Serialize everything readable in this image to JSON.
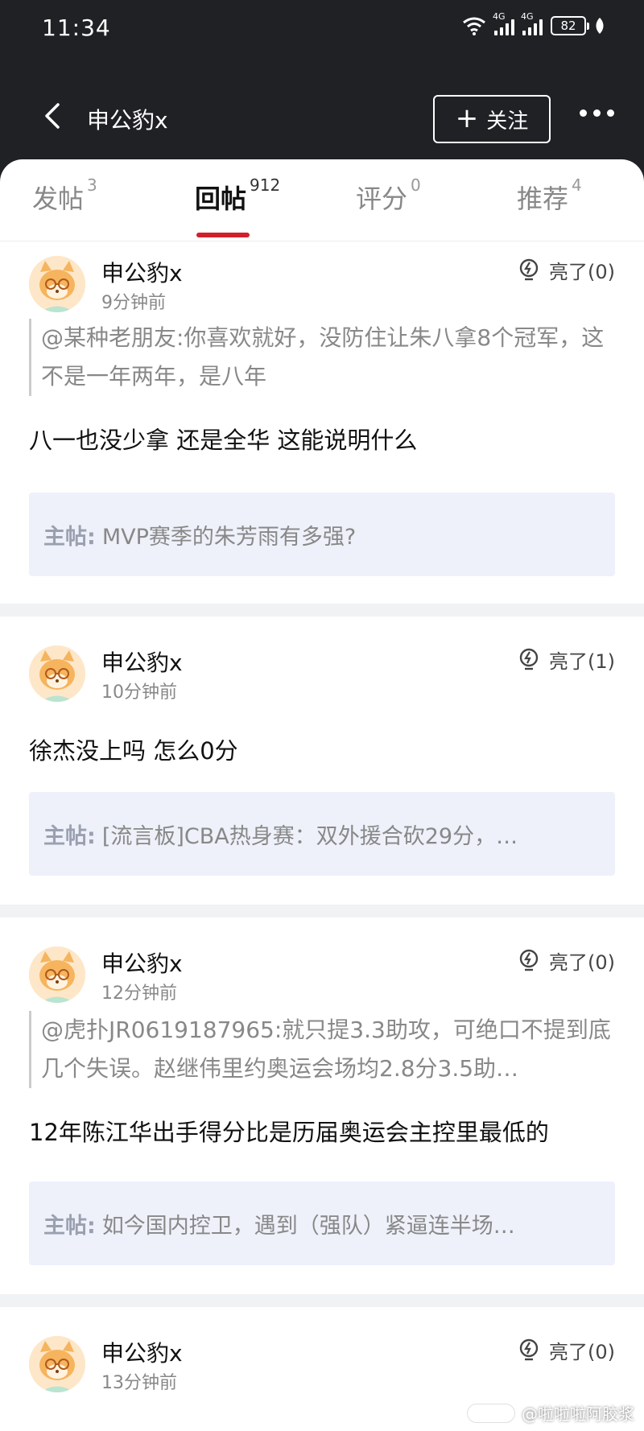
{
  "status_bar": {
    "time": "11:34",
    "signal_label_1": "4G",
    "signal_label_2": "4G",
    "battery": "82"
  },
  "header": {
    "title": "申公豹x",
    "follow_label": "关注"
  },
  "tabs": [
    {
      "label": "发帖",
      "count": "3",
      "active": false
    },
    {
      "label": "回帖",
      "count": "912",
      "active": true
    },
    {
      "label": "评分",
      "count": "0",
      "active": false
    },
    {
      "label": "推荐",
      "count": "4",
      "active": false
    }
  ],
  "main_post_label": "主帖:",
  "posts": [
    {
      "username": "申公豹x",
      "time": "9分钟前",
      "likes": "亮了(0)",
      "quote": "@某种老朋友:你喜欢就好，没防住让朱八拿8个冠军，这不是一年两年，是八年",
      "body": "八一也没少拿   还是全华  这能说明什么",
      "main_post": "MVP赛季的朱芳雨有多强?"
    },
    {
      "username": "申公豹x",
      "time": "10分钟前",
      "likes": "亮了(1)",
      "body": "徐杰没上吗  怎么0分",
      "main_post": "[流言板]CBA热身赛：双外援合砍29分，…"
    },
    {
      "username": "申公豹x",
      "time": "12分钟前",
      "likes": "亮了(0)",
      "quote": "@虎扑JR0619187965:就只提3.3助攻，可绝口不提到底几个失误。赵继伟里约奥运会场均2.8分3.5助…",
      "body": "12年陈江华出手得分比是历届奥运会主控里最低的",
      "main_post": "如今国内控卫，遇到（强队）紧逼连半场…"
    },
    {
      "username": "申公豹x",
      "time": "13分钟前",
      "likes": "亮了(0)"
    }
  ],
  "watermark": "@啦啦啦阿胶浆",
  "colors": {
    "header_bg": "#1f2125",
    "accent": "#d0202c",
    "main_post_bg": "#eef1fa"
  }
}
